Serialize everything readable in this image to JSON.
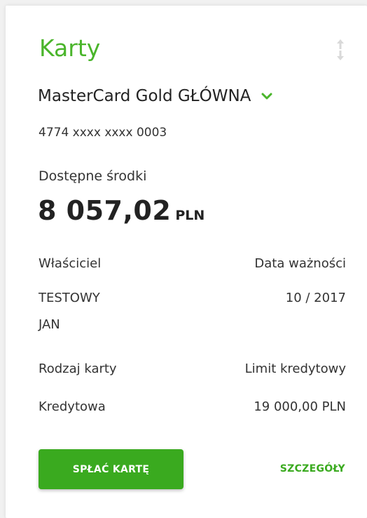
{
  "widget": {
    "title": "Karty",
    "icons": {
      "sort": "sort-arrows-icon",
      "expand": "chevron-down-icon"
    }
  },
  "card": {
    "name": "MasterCard Gold GŁÓWNA",
    "number": "4774 xxxx xxxx 0003"
  },
  "balance": {
    "label": "Dostępne środki",
    "amount": "8 057,02",
    "currency": "PLN"
  },
  "details": {
    "owner_label": "Właściciel",
    "owner_value_line1": "TESTOWY",
    "owner_value_line2": "JAN",
    "expiry_label": "Data ważności",
    "expiry_value": "10 / 2017",
    "type_label": "Rodzaj karty",
    "type_value": "Kredytowa",
    "limit_label": "Limit kredytowy",
    "limit_value": "19 000,00 PLN"
  },
  "actions": {
    "pay_label": "SPŁAĆ KARTĘ",
    "details_label": "SZCZEGÓŁY"
  },
  "colors": {
    "accent": "#4ab52b",
    "button": "#3aaa1f",
    "text": "#333333",
    "background": "#f1f1f1"
  }
}
